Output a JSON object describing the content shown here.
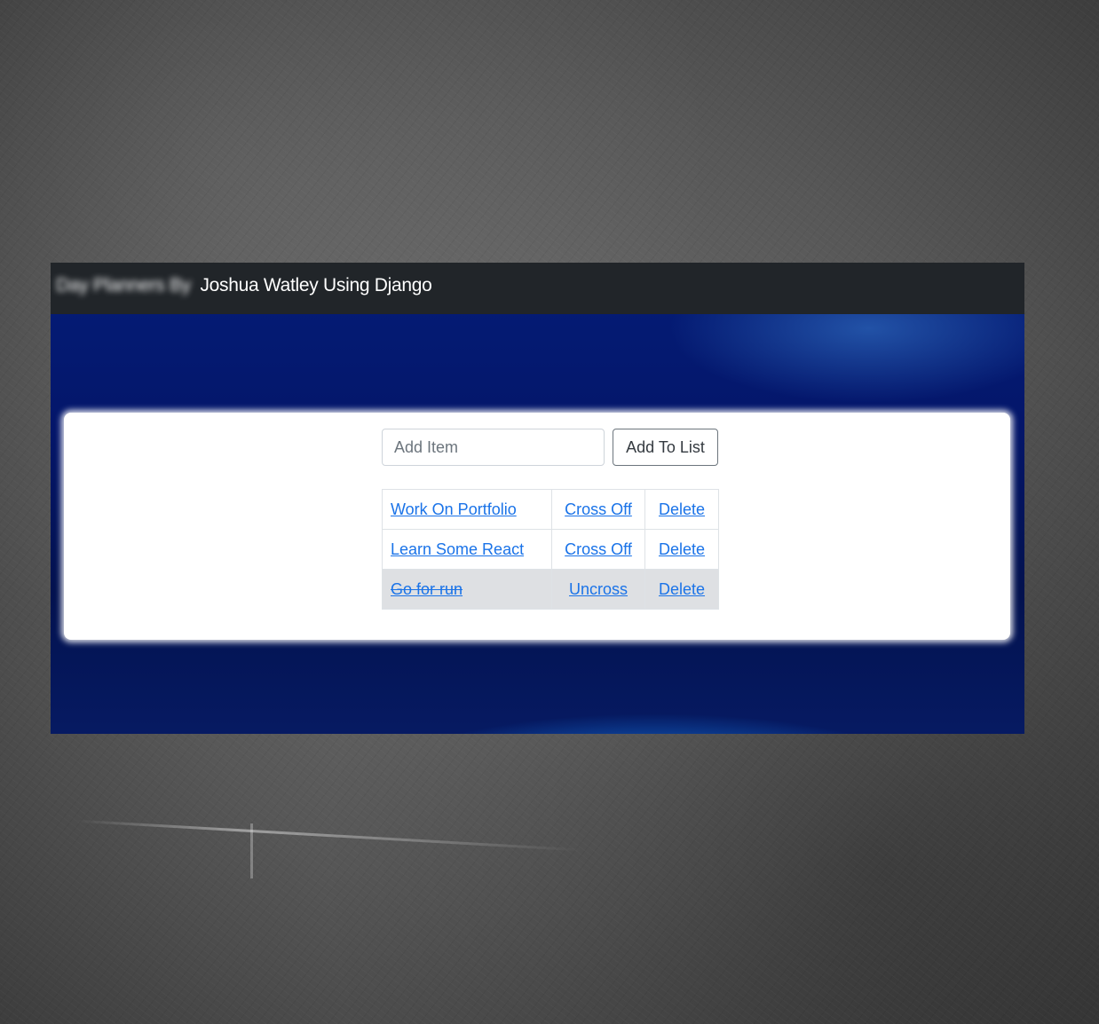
{
  "navbar": {
    "brand_blurred": "Day Planners By",
    "brand_clear": "Joshua Watley Using Django"
  },
  "form": {
    "input_placeholder": "Add Item",
    "input_value": "",
    "submit_label": "Add To List"
  },
  "todos": [
    {
      "item": "Work On Portfolio",
      "toggle_label": "Cross Off",
      "delete_label": "Delete",
      "completed": false
    },
    {
      "item": "Learn Some React",
      "toggle_label": "Cross Off",
      "delete_label": "Delete",
      "completed": false
    },
    {
      "item": "Go for run",
      "toggle_label": "Uncross",
      "delete_label": "Delete",
      "completed": true
    }
  ],
  "colors": {
    "navbar": "#212529",
    "link": "#1a73e8",
    "completed_row": "#dee0e3",
    "card": "#ffffff"
  }
}
